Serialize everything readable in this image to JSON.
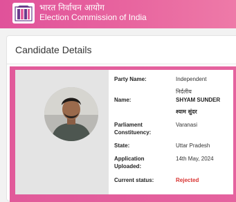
{
  "header": {
    "hindi_title": "भारत निर्वाचन आयोग",
    "english_title": "Election Commission of India",
    "logo_icon": "eci-ballot-logo-icon",
    "colors": {
      "start": "#e0529a",
      "end": "#ee7aa8"
    }
  },
  "card": {
    "title": "Candidate Details"
  },
  "candidate": {
    "photo_icon": "candidate-photo",
    "party_label": "Party Name:",
    "party_value": "Independent",
    "name_label": "Name:",
    "name_hindi_top": "निर्दलीय",
    "name_value": "SHYAM SUNDER",
    "name_hindi": "श्याम सुंदर",
    "constituency_label_1": "Parliament",
    "constituency_label_2": "Constituency:",
    "constituency_value": "Varanasi",
    "state_label": "State:",
    "state_value": "Uttar Pradesh",
    "uploaded_label_1": "Application",
    "uploaded_label_2": "Uploaded:",
    "uploaded_value": "14th May, 2024",
    "status_label": "Current status:",
    "status_value": "Rejected",
    "status_color": "#d8312f"
  }
}
